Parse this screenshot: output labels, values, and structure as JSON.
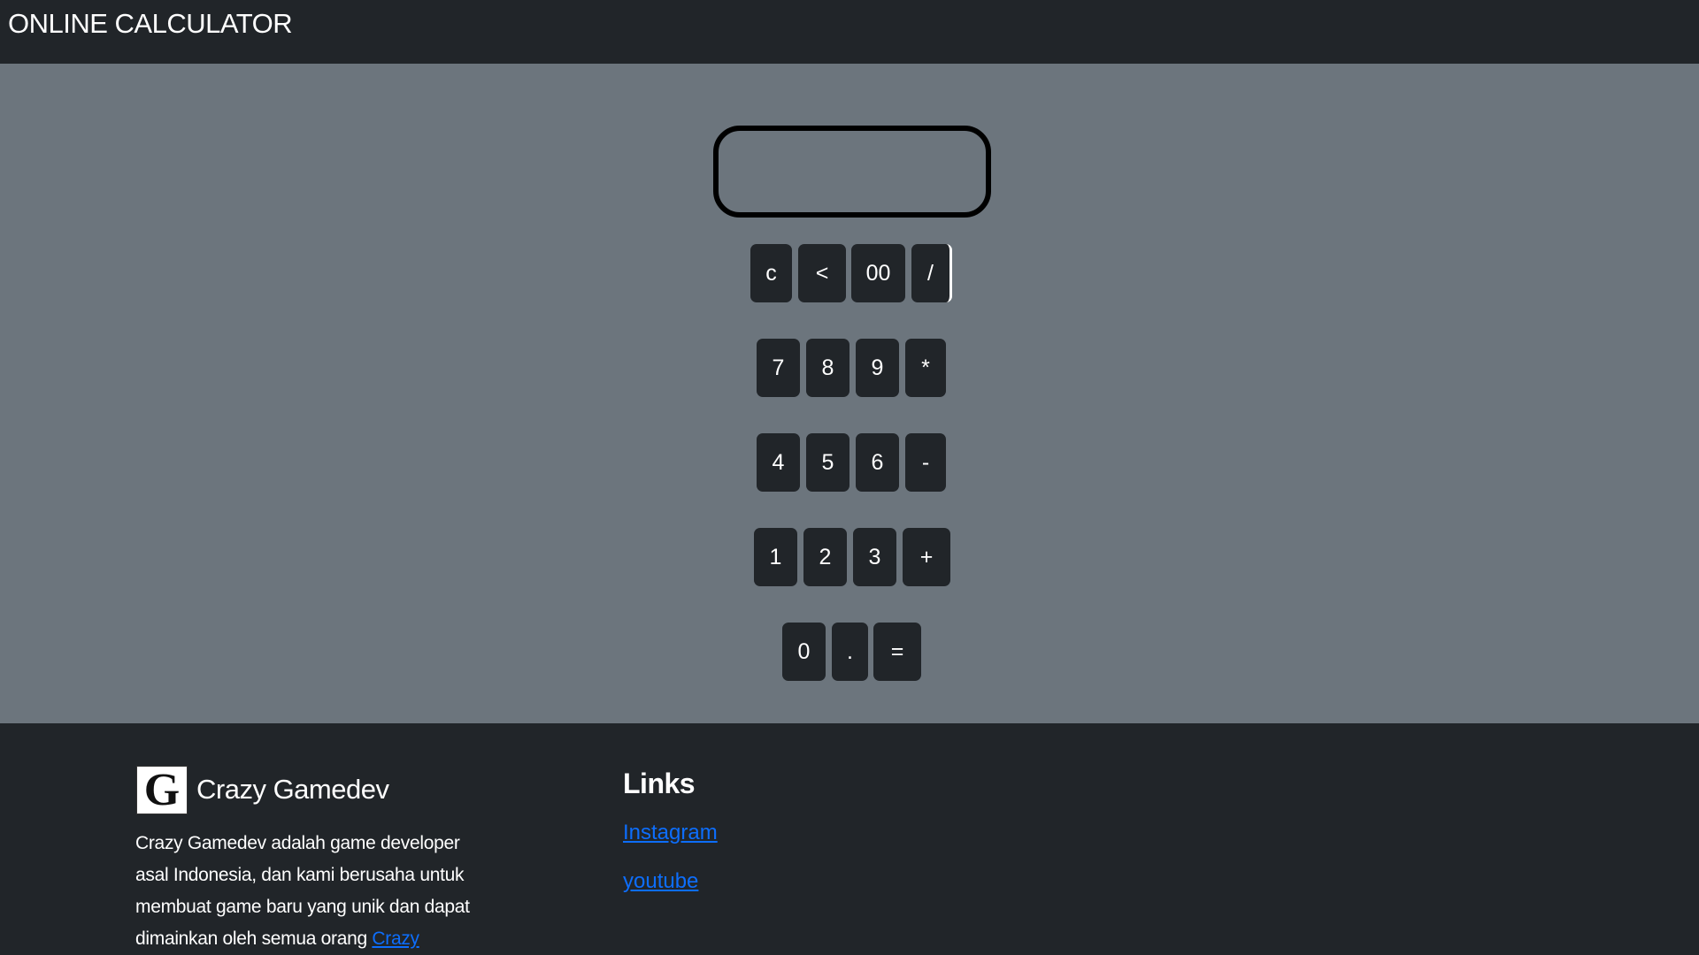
{
  "navbar": {
    "brand": "ONLINE CALCULATOR"
  },
  "calculator": {
    "display_value": "",
    "keys": {
      "clear": "c",
      "back": "<",
      "double_zero": "00",
      "divide": "/",
      "seven": "7",
      "eight": "8",
      "nine": "9",
      "multiply": "*",
      "four": "4",
      "five": "5",
      "six": "6",
      "minus": "-",
      "one": "1",
      "two": "2",
      "three": "3",
      "plus": "+",
      "zero": "0",
      "dot": ".",
      "equals": "="
    }
  },
  "footer": {
    "logo_letter": "G",
    "company_name": "Crazy Gamedev",
    "about_text": "Crazy Gamedev adalah game developer asal Indonesia, dan kami berusaha untuk membuat game baru yang unik dan dapat dimainkan oleh semua orang ",
    "about_link": "Crazy",
    "links_title": "Links",
    "links": {
      "instagram": "Instagram",
      "youtube": "youtube"
    }
  },
  "colors": {
    "navbar_bg": "#212529",
    "main_bg": "#6c757d",
    "key_bg": "#212529",
    "link": "#0d6efd"
  }
}
